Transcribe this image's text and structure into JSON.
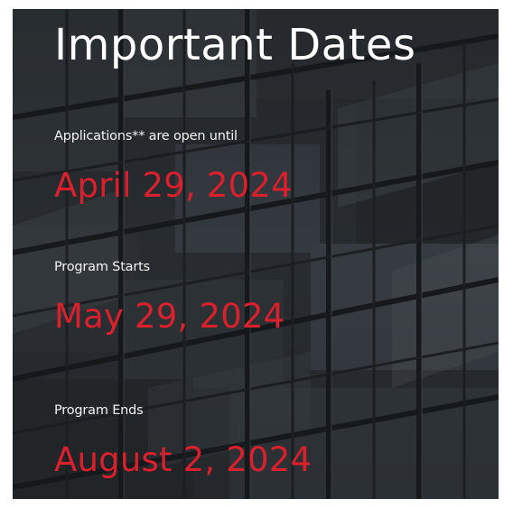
{
  "heading": "Important Dates",
  "dates": [
    {
      "label": "Applications** are open until",
      "date": "April 29, 2024"
    },
    {
      "label": "Program Starts",
      "date": "May 29, 2024"
    },
    {
      "label": "Program Ends",
      "date": "August 2, 2024"
    }
  ],
  "colors": {
    "date_accent": "#d9202c",
    "text": "#ffffff",
    "background": "#2a2e31"
  }
}
